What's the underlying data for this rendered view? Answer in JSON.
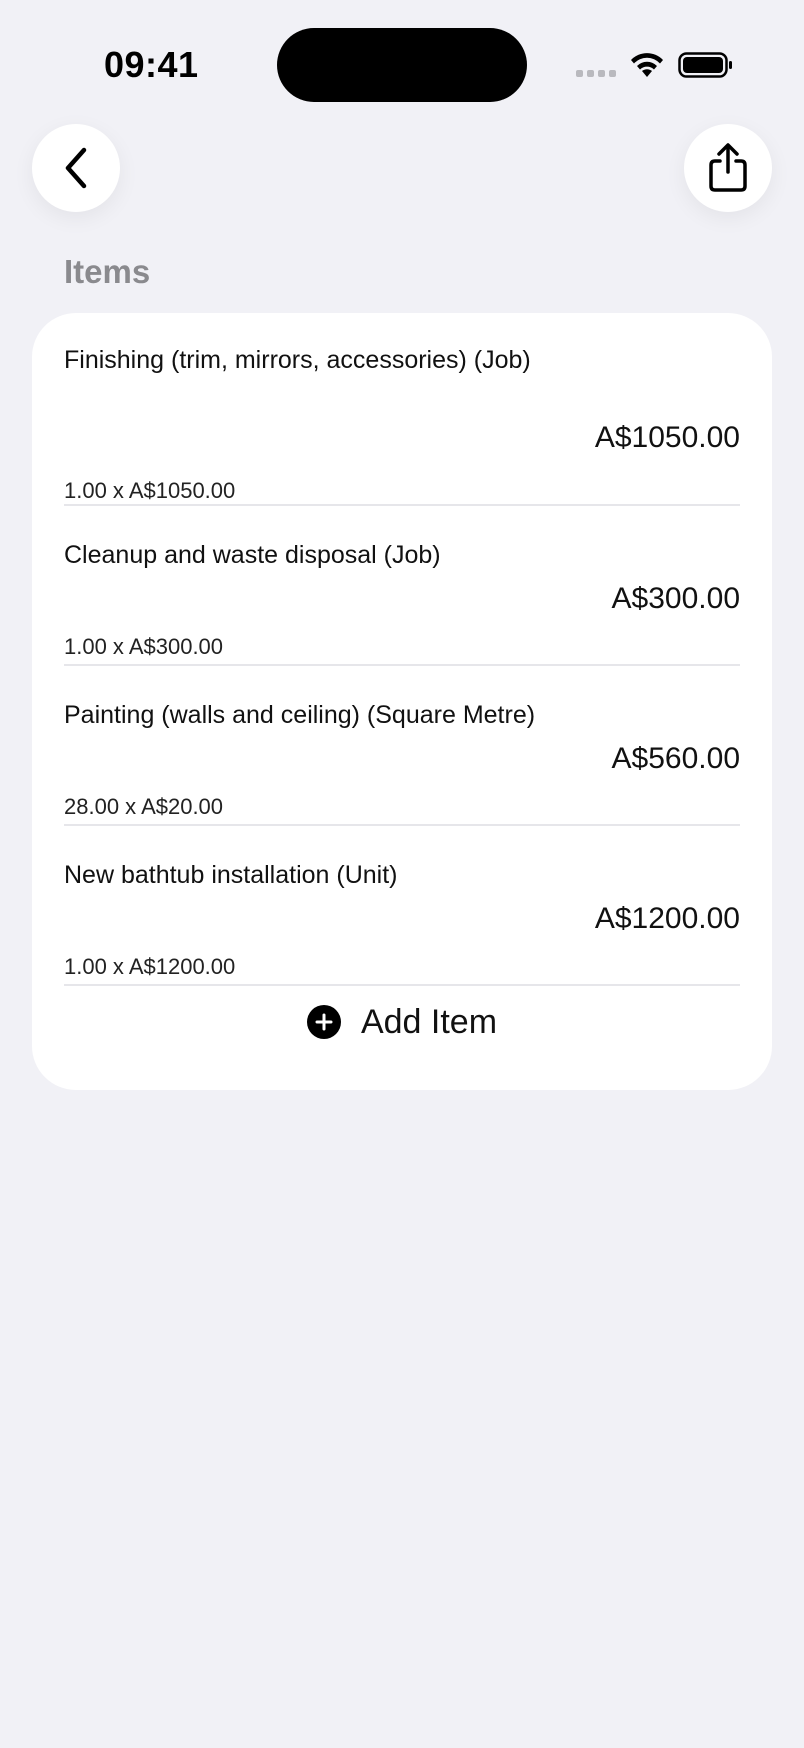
{
  "status_bar": {
    "time": "09:41"
  },
  "header": {
    "section_title": "Items"
  },
  "items": [
    {
      "name": "Finishing (trim, mirrors, accessories) (Job)",
      "qty_line": "1.00 x A$1050.00",
      "total": "A$1050.00"
    },
    {
      "name": "Cleanup and waste disposal (Job)",
      "qty_line": "1.00 x A$300.00",
      "total": "A$300.00"
    },
    {
      "name": "Painting (walls and ceiling) (Square Metre)",
      "qty_line": "28.00 x A$20.00",
      "total": "A$560.00"
    },
    {
      "name": "New bathtub installation (Unit)",
      "qty_line": "1.00 x A$1200.00",
      "total": "A$1200.00"
    }
  ],
  "add_item": {
    "label": "Add Item"
  },
  "icons": {
    "back": "chevron-left-icon",
    "share": "share-icon",
    "add": "plus-circle-icon",
    "wifi": "wifi-icon",
    "battery": "battery-icon"
  },
  "colors": {
    "background": "#f1f1f6",
    "card": "#ffffff",
    "section_title": "#8a8a8e"
  }
}
